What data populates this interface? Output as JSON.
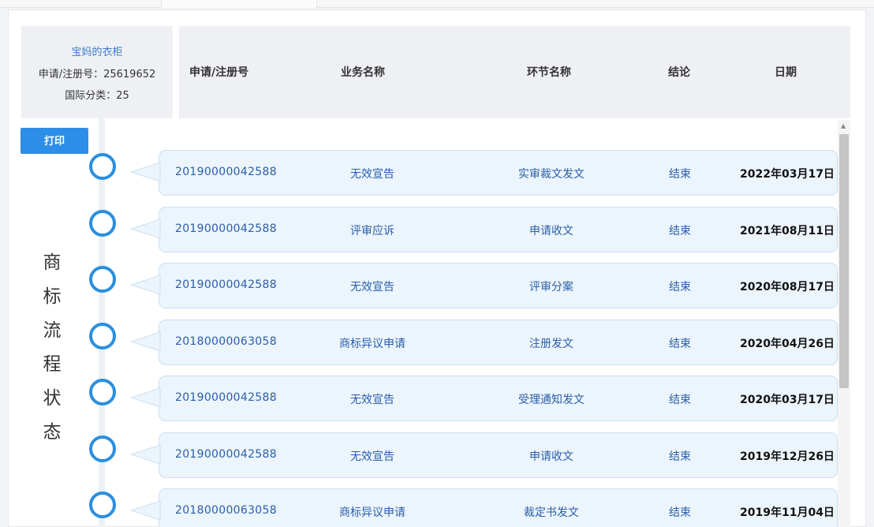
{
  "trademark": {
    "owner": "宝妈的衣柜",
    "reg_label": "申请/注册号：25619652",
    "class_label": "国际分类：25"
  },
  "actions": {
    "print_label": "打印"
  },
  "side_title": [
    "商",
    "标",
    "流",
    "程",
    "状",
    "态"
  ],
  "columns": {
    "app_no": "申请/注册号",
    "business": "业务名称",
    "node": "环节名称",
    "result": "结论",
    "date": "日期"
  },
  "rows": [
    {
      "app_no": "20190000042588",
      "business": "无效宣告",
      "node": "实审裁文发文",
      "result": "结束",
      "date": "2022年03月17日"
    },
    {
      "app_no": "20190000042588",
      "business": "评审应诉",
      "node": "申请收文",
      "result": "结束",
      "date": "2021年08月11日"
    },
    {
      "app_no": "20190000042588",
      "business": "无效宣告",
      "node": "评审分案",
      "result": "结束",
      "date": "2020年08月17日"
    },
    {
      "app_no": "20180000063058",
      "business": "商标异议申请",
      "node": "注册发文",
      "result": "结束",
      "date": "2020年04月26日"
    },
    {
      "app_no": "20190000042588",
      "business": "无效宣告",
      "node": "受理通知发文",
      "result": "结束",
      "date": "2020年03月17日"
    },
    {
      "app_no": "20190000042588",
      "business": "无效宣告",
      "node": "申请收文",
      "result": "结束",
      "date": "2019年12月26日"
    },
    {
      "app_no": "20180000063058",
      "business": "商标异议申请",
      "node": "裁定书发文",
      "result": "结束",
      "date": "2019年11月04日"
    }
  ],
  "colors": {
    "accent": "#2a8fdf",
    "link": "#2a5fa8",
    "row_bg": "#ecf4fc"
  }
}
